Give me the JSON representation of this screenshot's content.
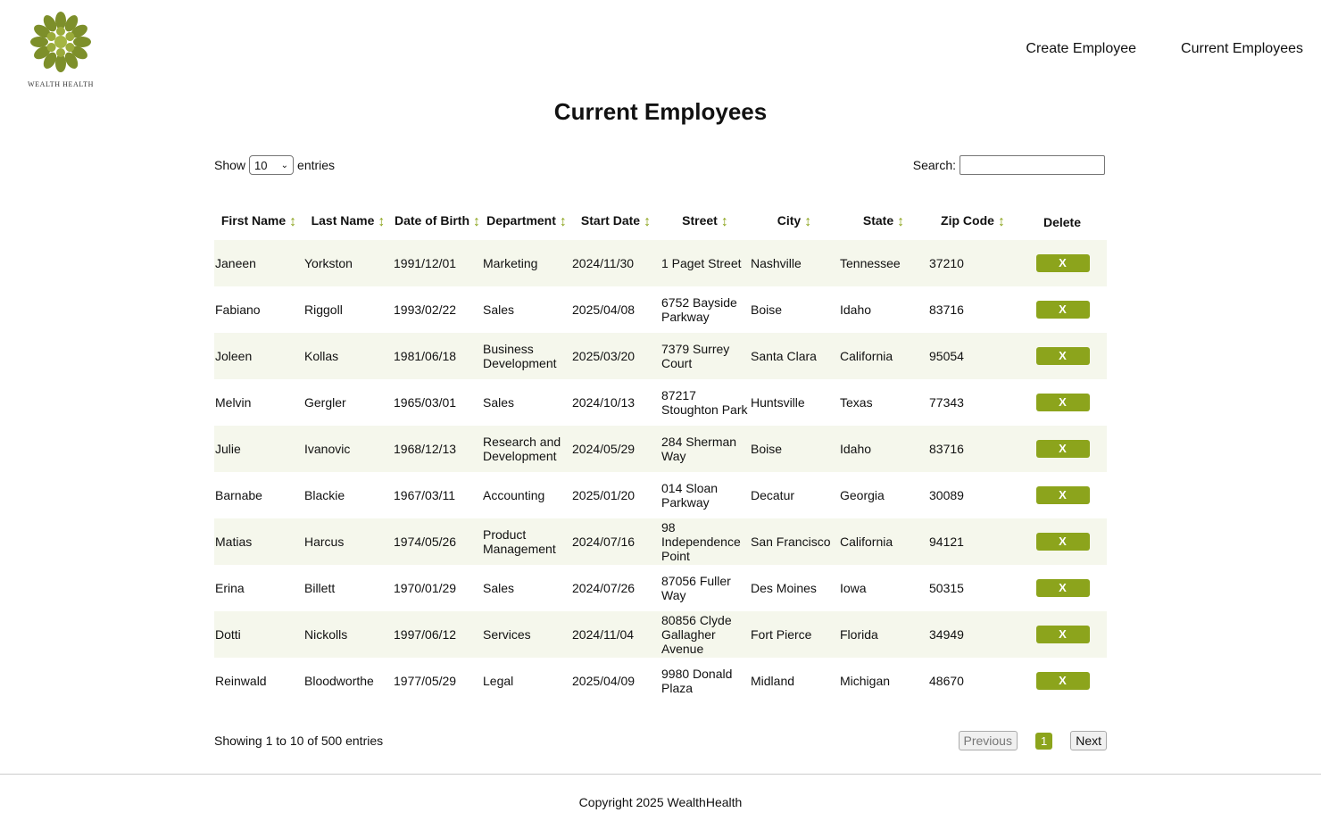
{
  "brand": {
    "name": "Wealth Health",
    "accent": "#8ca41c",
    "logo_icon": "flower-logo-icon"
  },
  "nav": {
    "create": "Create Employee",
    "current": "Current Employees"
  },
  "title": "Current Employees",
  "controls": {
    "show_label": "Show",
    "entries_value": "10",
    "entries_label": "entries",
    "search_label": "Search:",
    "search_value": ""
  },
  "table": {
    "headers": [
      "First Name",
      "Last Name",
      "Date of Birth",
      "Department",
      "Start Date",
      "Street",
      "City",
      "State",
      "Zip Code",
      "Delete"
    ],
    "delete_label": "X",
    "rows": [
      [
        "Janeen",
        "Yorkston",
        "1991/12/01",
        "Marketing",
        "2024/11/30",
        "1 Paget Street",
        "Nashville",
        "Tennessee",
        "37210"
      ],
      [
        "Fabiano",
        "Riggoll",
        "1993/02/22",
        "Sales",
        "2025/04/08",
        "6752 Bayside Parkway",
        "Boise",
        "Idaho",
        "83716"
      ],
      [
        "Joleen",
        "Kollas",
        "1981/06/18",
        "Business Development",
        "2025/03/20",
        "7379 Surrey Court",
        "Santa Clara",
        "California",
        "95054"
      ],
      [
        "Melvin",
        "Gergler",
        "1965/03/01",
        "Sales",
        "2024/10/13",
        "87217 Stoughton Park",
        "Huntsville",
        "Texas",
        "77343"
      ],
      [
        "Julie",
        "Ivanovic",
        "1968/12/13",
        "Research and Development",
        "2024/05/29",
        "284 Sherman Way",
        "Boise",
        "Idaho",
        "83716"
      ],
      [
        "Barnabe",
        "Blackie",
        "1967/03/11",
        "Accounting",
        "2025/01/20",
        "014 Sloan Parkway",
        "Decatur",
        "Georgia",
        "30089"
      ],
      [
        "Matias",
        "Harcus",
        "1974/05/26",
        "Product Management",
        "2024/07/16",
        "98 Independence Point",
        "San Francisco",
        "California",
        "94121"
      ],
      [
        "Erina",
        "Billett",
        "1970/01/29",
        "Sales",
        "2024/07/26",
        "87056 Fuller Way",
        "Des Moines",
        "Iowa",
        "50315"
      ],
      [
        "Dotti",
        "Nickolls",
        "1997/06/12",
        "Services",
        "2024/11/04",
        "80856 Clyde Gallagher Avenue",
        "Fort Pierce",
        "Florida",
        "34949"
      ],
      [
        "Reinwald",
        "Bloodworthe",
        "1977/05/29",
        "Legal",
        "2025/04/09",
        "9980 Donald Plaza",
        "Midland",
        "Michigan",
        "48670"
      ]
    ]
  },
  "info": "Showing 1 to 10 of 500 entries",
  "pagination": {
    "previous": "Previous",
    "page": "1",
    "next": "Next"
  },
  "footer": {
    "copyright": "Copyright 2025 WealthHealth"
  }
}
